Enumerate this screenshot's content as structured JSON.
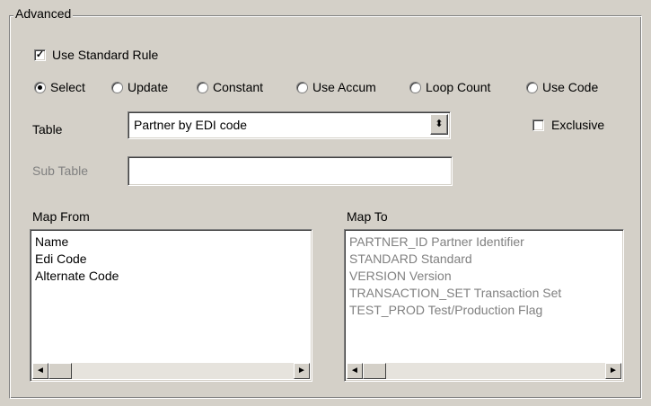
{
  "group": {
    "title": "Advanced"
  },
  "use_standard_rule": {
    "label": "Use Standard Rule",
    "checked": true,
    "mark": "✓"
  },
  "mode_options": [
    {
      "label": "Select",
      "checked": true
    },
    {
      "label": "Update",
      "checked": false
    },
    {
      "label": "Constant",
      "checked": false
    },
    {
      "label": "Use Accum",
      "checked": false
    },
    {
      "label": "Loop Count",
      "checked": false
    },
    {
      "label": "Use Code",
      "checked": false
    }
  ],
  "table": {
    "label": "Table",
    "value": "Partner by EDI code",
    "dropdown_glyph": "⬍"
  },
  "exclusive": {
    "label": "Exclusive",
    "checked": false
  },
  "sub_table": {
    "label": "Sub Table",
    "value": ""
  },
  "map_from": {
    "label": "Map From",
    "items": [
      "Name",
      "Edi Code",
      "Alternate Code"
    ]
  },
  "map_to": {
    "label": "Map To",
    "items": [
      "PARTNER_ID Partner Identifier",
      "STANDARD Standard",
      "VERSION Version",
      "TRANSACTION_SET Transaction Set",
      "TEST_PROD Test/Production Flag"
    ]
  },
  "scroll": {
    "left_glyph": "◄",
    "right_glyph": "►"
  }
}
